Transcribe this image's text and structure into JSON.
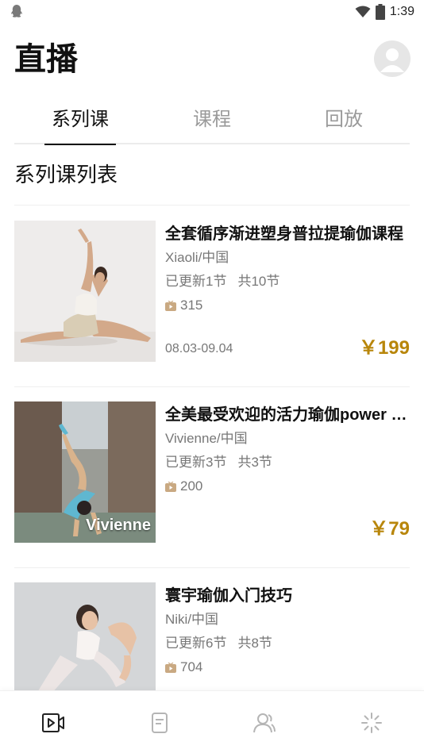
{
  "status_bar": {
    "time": "1:39",
    "icons": [
      "qq-icon",
      "wifi-icon",
      "battery-icon"
    ]
  },
  "header": {
    "title": "直播",
    "avatar_icon": "user-avatar-icon"
  },
  "tabs": [
    {
      "label": "系列课",
      "active": true
    },
    {
      "label": "课程",
      "active": false
    },
    {
      "label": "回放",
      "active": false
    }
  ],
  "section_title": "系列课列表",
  "courses": [
    {
      "title": "全套循序渐进塑身普拉提瑜伽课程",
      "teacher": "Xiaoli/中国",
      "updated": "已更新1节",
      "total": "共10节",
      "views": "315",
      "date": "08.03-09.04",
      "price": "￥199",
      "thumb_watermark": ""
    },
    {
      "title": "全美最受欢迎的活力瑜伽power yoga",
      "teacher": "Vivienne/中国",
      "updated": "已更新3节",
      "total": "共3节",
      "views": "200",
      "date": "",
      "price": "￥79",
      "thumb_watermark": "Vivienne"
    },
    {
      "title": "寰宇瑜伽入门技巧",
      "teacher": "Niki/中国",
      "updated": "已更新6节",
      "total": "共8节",
      "views": "704",
      "date": "",
      "price": "",
      "thumb_watermark": ""
    }
  ],
  "bottom_nav": [
    {
      "icon": "live-video-icon",
      "active": true
    },
    {
      "icon": "document-icon",
      "active": false
    },
    {
      "icon": "users-icon",
      "active": false
    },
    {
      "icon": "loading-icon",
      "active": false
    }
  ],
  "colors": {
    "price": "#b8860b",
    "muted": "#777777",
    "tab_inactive": "#9a9a9a",
    "views_icon": "#c9a982"
  }
}
